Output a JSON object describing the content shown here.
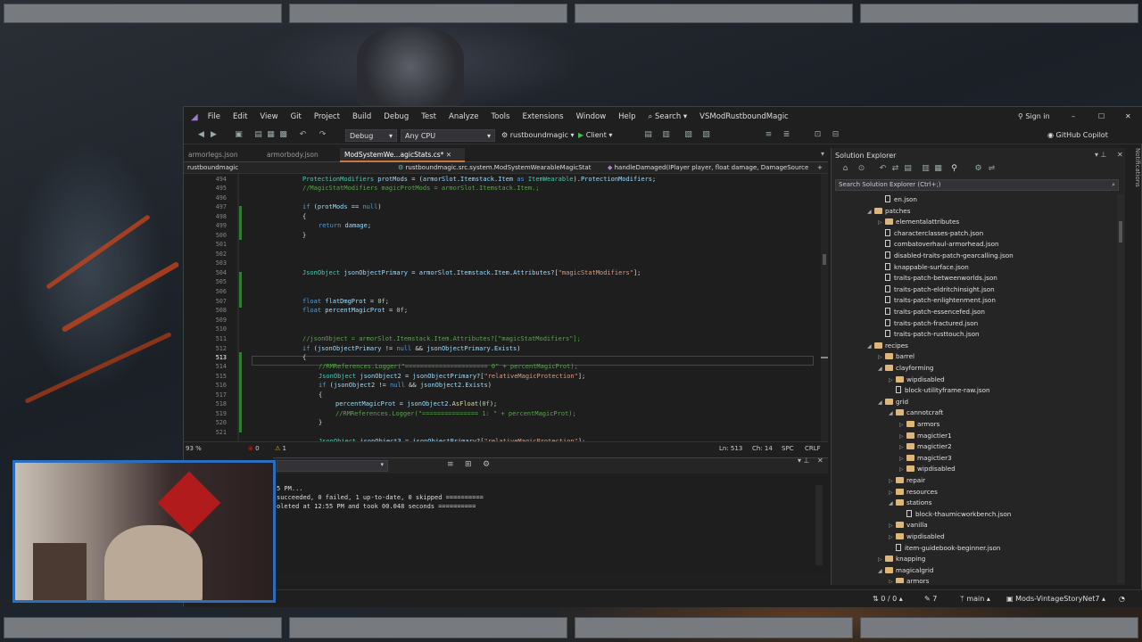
{
  "window": {
    "title": "VSModRustboundMagic",
    "sign_in": "Sign in",
    "copilot": "GitHub Copilot",
    "notifications": "Notifications"
  },
  "menus": [
    "File",
    "Edit",
    "View",
    "Git",
    "Project",
    "Build",
    "Debug",
    "Test",
    "Analyze",
    "Tools",
    "Extensions",
    "Window",
    "Help"
  ],
  "search": "Search",
  "toolbar": {
    "config": "Debug",
    "platform": "Any CPU",
    "startup": "rustboundmagic",
    "run": "Client"
  },
  "tabs": [
    "armorlegs.json",
    "armorbody.json",
    "ModSystemWe...agicStats.cs*"
  ],
  "navbar": {
    "project": "rustboundmagic",
    "class": "rustboundmagic.src.system.ModSystemWearableMagicStat",
    "member": "handleDamaged(IPlayer player, float damage, DamageSource"
  },
  "code": {
    "line_numbers": [
      "494",
      "495",
      "496",
      "497",
      "498",
      "499",
      "500",
      "501",
      "502",
      "503",
      "504",
      "505",
      "506",
      "507",
      "508",
      "509",
      "510",
      "511",
      "512",
      "513",
      "514",
      "515",
      "516",
      "517",
      "518",
      "519",
      "520",
      "521"
    ],
    "current_line": "513"
  },
  "statusbar": {
    "zoom": "93 %",
    "errors": "0",
    "warnings": "1",
    "ln": "Ln: 513",
    "ch": "Ch: 14",
    "spc": "SPC",
    "crlf": "CRLF"
  },
  "output": {
    "lines": [
      "5 PM...",
      "succeeded, 0 failed, 1 up-to-date, 0 skipped ==========",
      "oleted at 12:55 PM and took 00.048 seconds =========="
    ]
  },
  "solution_explorer": {
    "title": "Solution Explorer",
    "search_placeholder": "Search Solution Explorer (Ctrl+;)",
    "items": [
      {
        "label": "en.json",
        "kind": "file",
        "indent": 5
      },
      {
        "label": "patches",
        "kind": "folder",
        "indent": 4,
        "expanded": true
      },
      {
        "label": "elementalattributes",
        "kind": "folder",
        "indent": 5
      },
      {
        "label": "characterclasses-patch.json",
        "kind": "file",
        "indent": 5
      },
      {
        "label": "combatoverhaul-armorhead.json",
        "kind": "file",
        "indent": 5
      },
      {
        "label": "disabled-traits-patch-gearcalling.json",
        "kind": "file",
        "indent": 5
      },
      {
        "label": "knappable-surface.json",
        "kind": "file",
        "indent": 5
      },
      {
        "label": "traits-patch-betweenworlds.json",
        "kind": "file",
        "indent": 5
      },
      {
        "label": "traits-patch-eldritchinsight.json",
        "kind": "file",
        "indent": 5
      },
      {
        "label": "traits-patch-enlightenment.json",
        "kind": "file",
        "indent": 5
      },
      {
        "label": "traits-patch-essencefed.json",
        "kind": "file",
        "indent": 5
      },
      {
        "label": "traits-patch-fractured.json",
        "kind": "file",
        "indent": 5
      },
      {
        "label": "traits-patch-rusttouch.json",
        "kind": "file",
        "indent": 5
      },
      {
        "label": "recipes",
        "kind": "folder",
        "indent": 4,
        "expanded": true
      },
      {
        "label": "barrel",
        "kind": "folder",
        "indent": 5
      },
      {
        "label": "clayforming",
        "kind": "folder",
        "indent": 5,
        "expanded": true
      },
      {
        "label": "wipdisabled",
        "kind": "folder",
        "indent": 6
      },
      {
        "label": "block-utilityframe-raw.json",
        "kind": "file",
        "indent": 6
      },
      {
        "label": "grid",
        "kind": "folder",
        "indent": 5,
        "expanded": true
      },
      {
        "label": "cannotcraft",
        "kind": "folder",
        "indent": 6,
        "expanded": true
      },
      {
        "label": "armors",
        "kind": "folder",
        "indent": 7
      },
      {
        "label": "magictier1",
        "kind": "folder",
        "indent": 7
      },
      {
        "label": "magictier2",
        "kind": "folder",
        "indent": 7
      },
      {
        "label": "magictier3",
        "kind": "folder",
        "indent": 7
      },
      {
        "label": "wipdisabled",
        "kind": "folder",
        "indent": 7
      },
      {
        "label": "repair",
        "kind": "folder",
        "indent": 6
      },
      {
        "label": "resources",
        "kind": "folder",
        "indent": 6
      },
      {
        "label": "stations",
        "kind": "folder",
        "indent": 6,
        "expanded": true
      },
      {
        "label": "block-thaumicworkbench.json",
        "kind": "file",
        "indent": 7
      },
      {
        "label": "vanilla",
        "kind": "folder",
        "indent": 6
      },
      {
        "label": "wipdisabled",
        "kind": "folder",
        "indent": 6
      },
      {
        "label": "item-guidebook-beginner.json",
        "kind": "file",
        "indent": 6
      },
      {
        "label": "knapping",
        "kind": "folder",
        "indent": 5
      },
      {
        "label": "magicalgrid",
        "kind": "folder",
        "indent": 5,
        "expanded": true
      },
      {
        "label": "armors",
        "kind": "folder",
        "indent": 6
      }
    ]
  },
  "bottombar": {
    "changes": "0 / 0",
    "pending": "7",
    "branch": "main",
    "repo": "Mods-VintageStoryNet7"
  }
}
